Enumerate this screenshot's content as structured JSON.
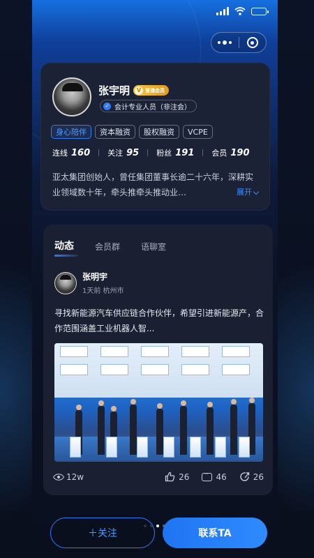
{
  "profile": {
    "name": "张宇明",
    "vip_badge": "普通会员",
    "vip_badge_icon": "V",
    "certification": "会计专业人员（非注会）",
    "tags": [
      "身心陪伴",
      "资本融资",
      "股权融资",
      "VCPE"
    ],
    "stats": [
      {
        "label": "连线",
        "value": "160"
      },
      {
        "label": "关注",
        "value": "95"
      },
      {
        "label": "粉丝",
        "value": "191"
      },
      {
        "label": "会员",
        "value": "190"
      }
    ],
    "bio": "亚太集团创始人，曾任集团董事长逾二十六年，深耕实业领域数十年，牵头推牵头推动业…",
    "expand_label": "展开"
  },
  "feed": {
    "tabs": [
      "动态",
      "会员群",
      "语聊室"
    ],
    "active_tab": 0,
    "post": {
      "author": "张明宇",
      "meta": "1天前  杭州市",
      "text": "寻找新能源汽车供应链合作伙伴，希望引进新能源产，合作范围涵盖工业机器人智...",
      "views": "12w",
      "likes": "26",
      "comments": "46",
      "shares": "26"
    }
  },
  "actions": {
    "follow_label": "＋关注",
    "contact_label": "联系TA"
  },
  "colors": {
    "accent": "#2f7cf6",
    "card_bg": "#1b2236",
    "page_bg": "#0a0f1e",
    "vip_gold": "#f5c542"
  },
  "icons": [
    "signal-icon",
    "wifi-icon",
    "battery-icon",
    "more-icon",
    "target-icon",
    "verified-icon",
    "chevron-down-icon",
    "eye-icon",
    "like-icon",
    "comment-icon",
    "share-icon"
  ]
}
